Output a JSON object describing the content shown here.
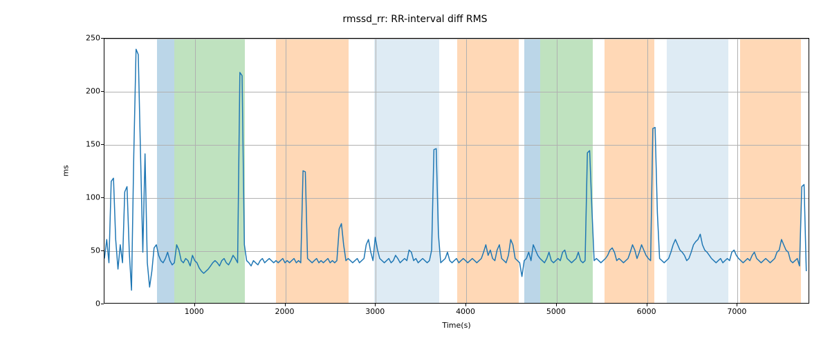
{
  "chart_data": {
    "type": "line",
    "title": "rmssd_rr: RR-interval diff RMS",
    "xlabel": "Time(s)",
    "ylabel": "ms",
    "xlim": [
      0,
      7800
    ],
    "ylim": [
      0,
      250
    ],
    "xticks": [
      1000,
      2000,
      3000,
      4000,
      5000,
      6000,
      7000
    ],
    "yticks": [
      0,
      50,
      100,
      150,
      200,
      250
    ],
    "bands": [
      {
        "x0": 580,
        "x1": 770,
        "color": "#1f77b4"
      },
      {
        "x0": 770,
        "x1": 1550,
        "color": "#2ca02c"
      },
      {
        "x0": 1900,
        "x1": 2700,
        "color": "#ff7f0e"
      },
      {
        "x0": 2980,
        "x1": 3700,
        "color": "#1f77b4",
        "alpha": 0.15
      },
      {
        "x0": 3900,
        "x1": 4580,
        "color": "#ff7f0e"
      },
      {
        "x0": 4640,
        "x1": 4820,
        "color": "#1f77b4"
      },
      {
        "x0": 4820,
        "x1": 5400,
        "color": "#2ca02c"
      },
      {
        "x0": 5530,
        "x1": 6080,
        "color": "#ff7f0e"
      },
      {
        "x0": 6220,
        "x1": 6900,
        "color": "#1f77b4",
        "alpha": 0.15
      },
      {
        "x0": 6990,
        "x1": 7020,
        "color": "#ffffff"
      },
      {
        "x0": 7030,
        "x1": 7700,
        "color": "#ff7f0e"
      }
    ],
    "series": [
      {
        "name": "rmssd_rr",
        "color": "#1f77b4",
        "x_step": 25,
        "y": [
          42,
          60,
          38,
          115,
          118,
          60,
          32,
          55,
          38,
          105,
          110,
          48,
          12,
          140,
          240,
          235,
          140,
          48,
          141,
          38,
          15,
          30,
          52,
          55,
          45,
          40,
          38,
          42,
          48,
          40,
          36,
          38,
          55,
          50,
          40,
          38,
          42,
          40,
          35,
          45,
          40,
          38,
          33,
          30,
          28,
          30,
          32,
          35,
          38,
          40,
          38,
          35,
          40,
          42,
          38,
          36,
          40,
          45,
          42,
          38,
          218,
          215,
          55,
          40,
          38,
          35,
          40,
          38,
          36,
          40,
          42,
          38,
          40,
          42,
          40,
          38,
          40,
          38,
          40,
          42,
          38,
          40,
          38,
          40,
          42,
          38,
          40,
          38,
          125,
          124,
          42,
          40,
          38,
          40,
          42,
          38,
          40,
          38,
          40,
          42,
          38,
          40,
          38,
          40,
          70,
          75,
          55,
          40,
          42,
          40,
          38,
          40,
          42,
          38,
          40,
          42,
          55,
          60,
          48,
          40,
          62,
          50,
          42,
          40,
          38,
          40,
          42,
          38,
          40,
          45,
          42,
          38,
          40,
          42,
          40,
          50,
          48,
          40,
          42,
          38,
          40,
          42,
          40,
          38,
          40,
          50,
          145,
          146,
          65,
          38,
          40,
          42,
          48,
          40,
          38,
          40,
          42,
          38,
          40,
          42,
          40,
          38,
          40,
          42,
          40,
          38,
          40,
          42,
          48,
          55,
          45,
          50,
          42,
          40,
          50,
          55,
          42,
          40,
          38,
          45,
          60,
          55,
          42,
          40,
          38,
          25,
          40,
          42,
          48,
          40,
          55,
          50,
          45,
          42,
          40,
          38,
          42,
          48,
          40,
          38,
          40,
          42,
          40,
          48,
          50,
          42,
          40,
          38,
          40,
          42,
          48,
          40,
          38,
          40,
          142,
          144,
          88,
          40,
          42,
          40,
          38,
          40,
          42,
          45,
          50,
          52,
          48,
          40,
          42,
          40,
          38,
          40,
          42,
          48,
          55,
          50,
          42,
          48,
          55,
          50,
          45,
          42,
          40,
          165,
          166,
          85,
          42,
          40,
          38,
          40,
          42,
          48,
          55,
          60,
          55,
          50,
          48,
          45,
          40,
          42,
          48,
          55,
          58,
          60,
          65,
          55,
          50,
          48,
          45,
          42,
          40,
          38,
          40,
          42,
          38,
          40,
          42,
          40,
          48,
          50,
          45,
          42,
          40,
          38,
          40,
          42,
          40,
          45,
          48,
          42,
          40,
          38,
          40,
          42,
          40,
          38,
          40,
          42,
          48,
          50,
          60,
          55,
          50,
          48,
          40,
          38,
          40,
          42,
          35,
          110,
          112,
          30
        ]
      }
    ]
  }
}
